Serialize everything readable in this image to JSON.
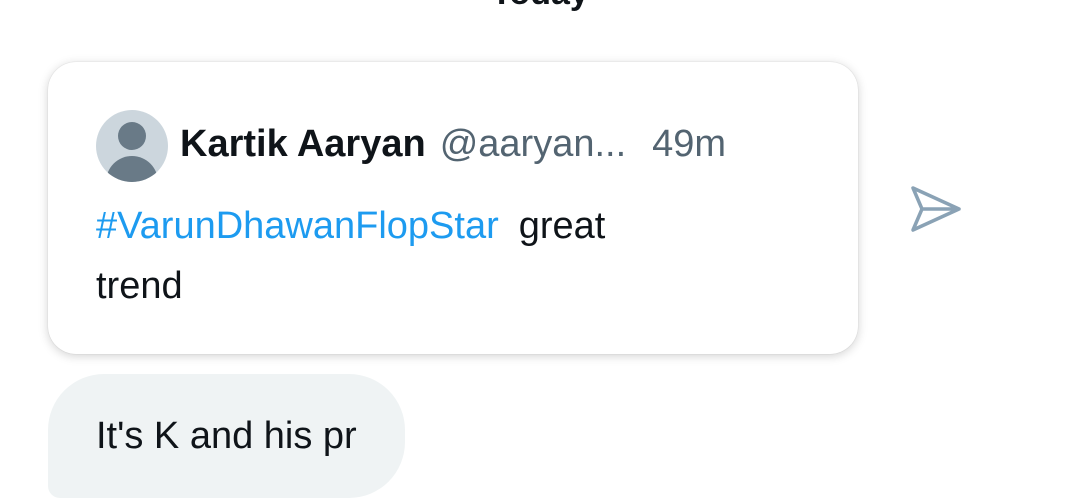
{
  "date_header": "Today",
  "tweet": {
    "author_name": "Kartik Aaryan",
    "author_handle": "@aaryan...",
    "time": "49m",
    "hashtag": "#VarunDhawanFlopStar",
    "text_line1": "great",
    "text_line2": "trend"
  },
  "share": {
    "icon": "send-icon",
    "color": "#8aa2b5"
  },
  "message": {
    "text": "It's K and his pr"
  },
  "colors": {
    "link": "#1d9bf0",
    "secondary_text": "#536471",
    "bubble_bg": "#eff3f4"
  }
}
